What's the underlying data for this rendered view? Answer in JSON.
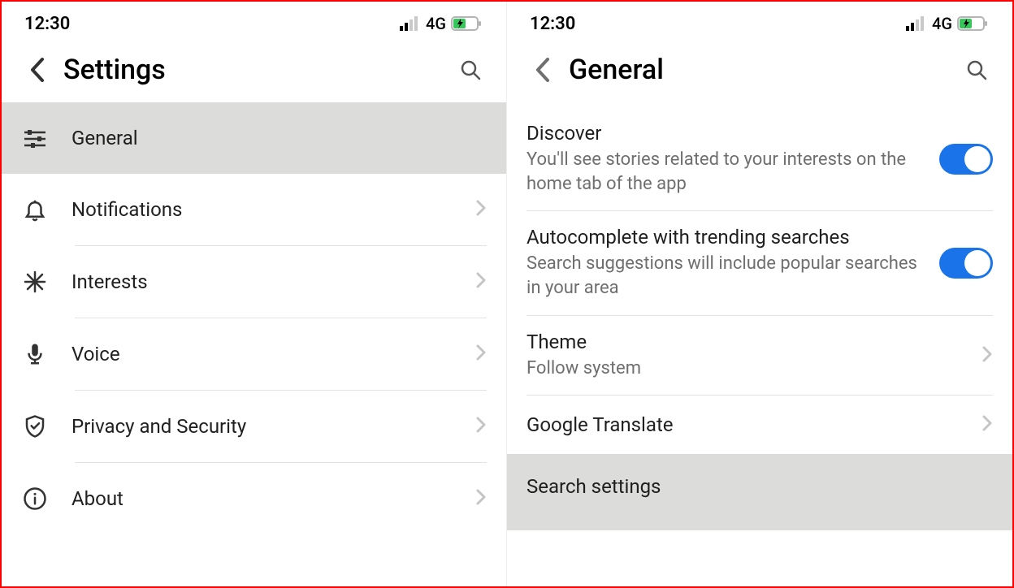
{
  "status": {
    "time": "12:30",
    "network": "4G"
  },
  "left": {
    "title": "Settings",
    "items": [
      {
        "label": "General"
      },
      {
        "label": "Notifications"
      },
      {
        "label": "Interests"
      },
      {
        "label": "Voice"
      },
      {
        "label": "Privacy and Security"
      },
      {
        "label": "About"
      }
    ]
  },
  "right": {
    "title": "General",
    "rows": {
      "discover": {
        "title": "Discover",
        "subtitle": "You'll see stories related to your interests on the home tab of the app",
        "toggle": true
      },
      "autocomplete": {
        "title": "Autocomplete with trending searches",
        "subtitle": "Search suggestions will include popular searches in your area",
        "toggle": true
      },
      "theme": {
        "title": "Theme",
        "subtitle": "Follow system"
      },
      "translate": {
        "title": "Google Translate"
      },
      "searchsettings": {
        "title": "Search settings"
      }
    }
  },
  "colors": {
    "accent": "#1a73e8"
  }
}
